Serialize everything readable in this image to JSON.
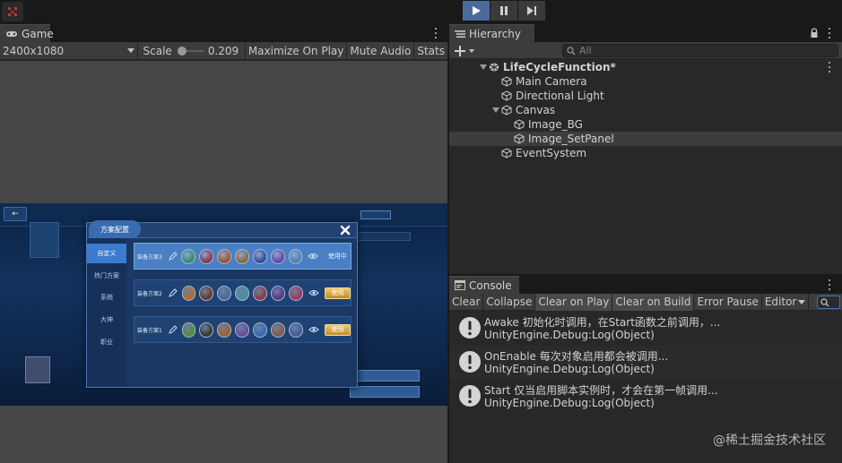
{
  "toolbar": {
    "logo_icon": "unity-collab-icon",
    "play_controls": [
      {
        "name": "play",
        "icon": "play-icon",
        "active": true
      },
      {
        "name": "pause",
        "icon": "pause-icon",
        "active": false
      },
      {
        "name": "step",
        "icon": "step-icon",
        "active": false
      }
    ]
  },
  "game": {
    "tab_label": "Game",
    "resolution": "2400x1080",
    "scale_label": "Scale",
    "scale_value": "0.209",
    "maximize_label": "Maximize On Play",
    "mute_label": "Mute Audio",
    "stats_label": "Stats",
    "scene": {
      "back_label": "←",
      "dialog_title": "方案配置",
      "tabs": [
        "自定义",
        "热门方案",
        "系统",
        "大神",
        "职业"
      ],
      "active_tab": 0,
      "plans": [
        {
          "name": "装备方案3",
          "status": "使用中",
          "selected": true,
          "hero_colors": [
            "#3f8a6a",
            "#8a3b4a",
            "#a5552d",
            "#8a6a3a",
            "#3a4f8f",
            "#6a4aa0",
            "#5a7fb0"
          ]
        },
        {
          "name": "装备方案2",
          "status": "使用",
          "selected": false,
          "hero_colors": [
            "#b36a2a",
            "#6a3a2a",
            "#4a6a9a",
            "#4a8fa0",
            "#8a3a4a",
            "#5a3a8a",
            "#a03a5a"
          ]
        },
        {
          "name": "装备方案1",
          "status": "使用",
          "selected": false,
          "hero_colors": [
            "#5a8a3a",
            "#3a3a2a",
            "#a0602a",
            "#6a4aa0",
            "#3a6ab0",
            "#8a5a4a",
            "#4a5aa0"
          ]
        }
      ]
    }
  },
  "hierarchy": {
    "tab_label": "Hierarchy",
    "search_placeholder": "All",
    "items": [
      {
        "label": "LifeCycleFunction*",
        "depth": 0,
        "type": "scene",
        "fold": "open"
      },
      {
        "label": "Main Camera",
        "depth": 1,
        "type": "object",
        "fold": "none"
      },
      {
        "label": "Directional Light",
        "depth": 1,
        "type": "object",
        "fold": "none"
      },
      {
        "label": "Canvas",
        "depth": 1,
        "type": "object",
        "fold": "open"
      },
      {
        "label": "Image_BG",
        "depth": 2,
        "type": "object",
        "fold": "none"
      },
      {
        "label": "Image_SetPanel",
        "depth": 2,
        "type": "object",
        "fold": "none",
        "selected": true
      },
      {
        "label": "EventSystem",
        "depth": 1,
        "type": "object",
        "fold": "none"
      }
    ]
  },
  "console": {
    "tab_label": "Console",
    "buttons": {
      "clear": "Clear",
      "collapse": "Collapse",
      "clear_on_play": "Clear on Play",
      "clear_on_build": "Clear on Build",
      "error_pause": "Error Pause",
      "editor": "Editor"
    },
    "logs": [
      {
        "line1": "Awake 初始化时调用，在Start函数之前调用，...",
        "line2": "UnityEngine.Debug:Log(Object)"
      },
      {
        "line1": "OnEnable 每次对象启用都会被调用...",
        "line2": "UnityEngine.Debug:Log(Object)"
      },
      {
        "line1": "Start 仅当启用脚本实例时，才会在第一帧调用...",
        "line2": "UnityEngine.Debug:Log(Object)"
      }
    ],
    "watermark": "@稀土掘金技术社区"
  },
  "colors": {
    "play_active": "#4b6b9a",
    "selection": "#3d3d3d",
    "panel_bg": "#282828",
    "toolbar_bg": "#3c3c3c"
  }
}
